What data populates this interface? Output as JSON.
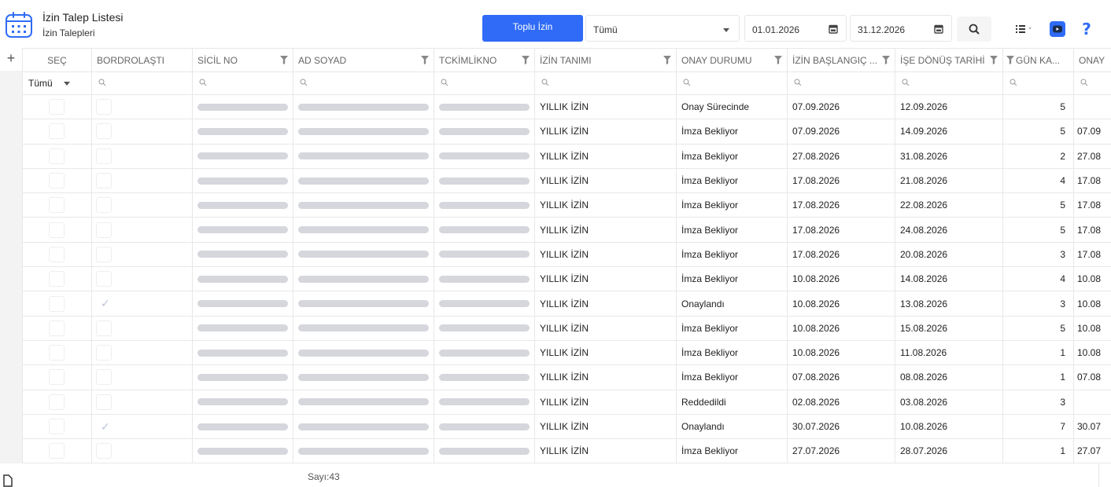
{
  "header": {
    "title": "İzin Talep Listesi",
    "subtitle": "İzin Talepleri"
  },
  "toolbar": {
    "bulk_button": "Toplu İzin",
    "status_select": "Tümü",
    "start_date": "01.01.2026",
    "end_date": "31.12.2026",
    "help_label": "?"
  },
  "grid": {
    "columns": [
      "SEÇ",
      "BORDROLAŞTI",
      "SİCİL NO",
      "AD SOYAD",
      "TCKİMLİKNO",
      "İZİN TANIMI",
      "ONAY DURUMU",
      "İZİN BAŞLANGIÇ ...",
      "İŞE DÖNÜŞ TARİHİ",
      "GÜN KA...",
      "ONAY"
    ],
    "select_filter": "Tümü",
    "rows": [
      {
        "payroll": false,
        "leave_type": "YILLIK İZİN",
        "status": "Onay Sürecinde",
        "start": "07.09.2026",
        "return": "12.09.2026",
        "days": "5",
        "approval": ""
      },
      {
        "payroll": false,
        "leave_type": "YILLIK İZİN",
        "status": "İmza Bekliyor",
        "start": "07.09.2026",
        "return": "14.09.2026",
        "days": "5",
        "approval": "07.09"
      },
      {
        "payroll": false,
        "leave_type": "YILLIK İZİN",
        "status": "İmza Bekliyor",
        "start": "27.08.2026",
        "return": "31.08.2026",
        "days": "2",
        "approval": "27.08"
      },
      {
        "payroll": false,
        "leave_type": "YILLIK İZİN",
        "status": "İmza Bekliyor",
        "start": "17.08.2026",
        "return": "21.08.2026",
        "days": "4",
        "approval": "17.08"
      },
      {
        "payroll": false,
        "leave_type": "YILLIK İZİN",
        "status": "İmza Bekliyor",
        "start": "17.08.2026",
        "return": "22.08.2026",
        "days": "5",
        "approval": "17.08"
      },
      {
        "payroll": false,
        "leave_type": "YILLIK İZİN",
        "status": "İmza Bekliyor",
        "start": "17.08.2026",
        "return": "24.08.2026",
        "days": "5",
        "approval": "17.08"
      },
      {
        "payroll": false,
        "leave_type": "YILLIK İZİN",
        "status": "İmza Bekliyor",
        "start": "17.08.2026",
        "return": "20.08.2026",
        "days": "3",
        "approval": "17.08"
      },
      {
        "payroll": false,
        "leave_type": "YILLIK İZİN",
        "status": "İmza Bekliyor",
        "start": "10.08.2026",
        "return": "14.08.2026",
        "days": "4",
        "approval": "10.08"
      },
      {
        "payroll": true,
        "leave_type": "YILLIK İZİN",
        "status": "Onaylandı",
        "start": "10.08.2026",
        "return": "13.08.2026",
        "days": "3",
        "approval": "10.08"
      },
      {
        "payroll": false,
        "leave_type": "YILLIK İZİN",
        "status": "İmza Bekliyor",
        "start": "10.08.2026",
        "return": "15.08.2026",
        "days": "5",
        "approval": "10.08"
      },
      {
        "payroll": false,
        "leave_type": "YILLIK İZİN",
        "status": "İmza Bekliyor",
        "start": "10.08.2026",
        "return": "11.08.2026",
        "days": "1",
        "approval": "10.08"
      },
      {
        "payroll": false,
        "leave_type": "YILLIK İZİN",
        "status": "İmza Bekliyor",
        "start": "07.08.2026",
        "return": "08.08.2026",
        "days": "1",
        "approval": "07.08"
      },
      {
        "payroll": false,
        "leave_type": "YILLIK İZİN",
        "status": "Reddedildi",
        "start": "02.08.2026",
        "return": "03.08.2026",
        "days": "3",
        "approval": ""
      },
      {
        "payroll": true,
        "leave_type": "YILLIK İZİN",
        "status": "Onaylandı",
        "start": "30.07.2026",
        "return": "10.08.2026",
        "days": "7",
        "approval": "30.07"
      },
      {
        "payroll": false,
        "leave_type": "YILLIK İZİN",
        "status": "İmza Bekliyor",
        "start": "27.07.2026",
        "return": "28.07.2026",
        "days": "1",
        "approval": "27.07"
      }
    ]
  },
  "footer": {
    "count": "Sayı:43"
  },
  "colors": {
    "primary": "#2f6bf6",
    "placeholder_bar": "#d5d7dd",
    "border": "#e8e8e8"
  }
}
